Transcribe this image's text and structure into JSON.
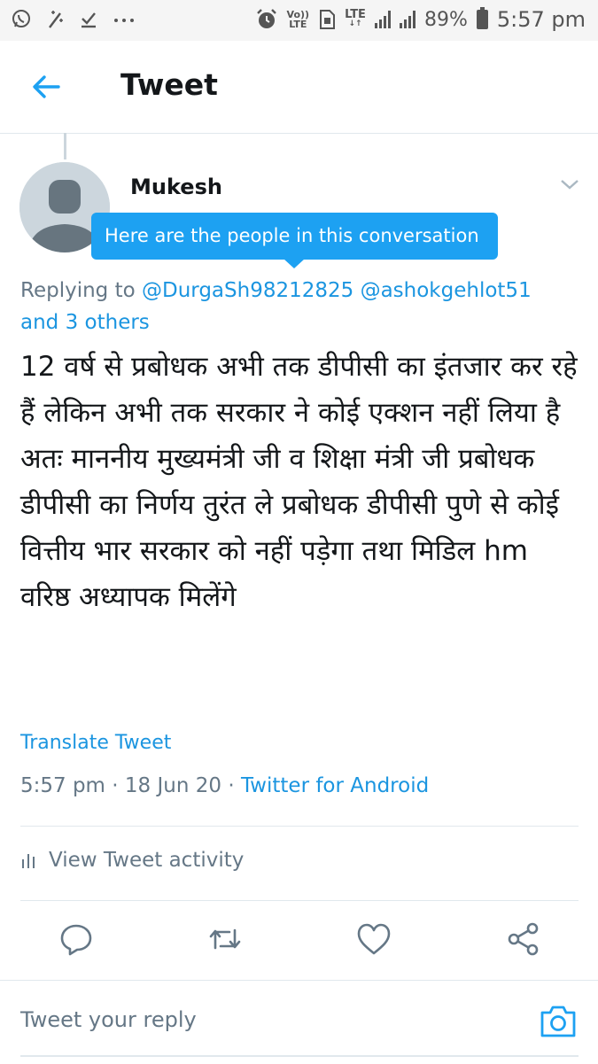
{
  "status_bar": {
    "volte_top": "Vo))",
    "volte_bottom": "LTE",
    "lte_label": "LTE",
    "battery_percent": "89%",
    "time": "5:57 pm"
  },
  "header": {
    "title": "Tweet"
  },
  "tweet": {
    "author_name": "Mukesh",
    "tooltip": "Here are the people in this conversation",
    "replying_prefix": "Replying to",
    "mention_1": "@DurgaSh98212825",
    "mention_2": "@ashokgehlot51",
    "others": "and 3 others",
    "text": "12 वर्ष से प्रबोधक अभी तक डीपीसी का इंतजार कर रहे हैं लेकिन अभी तक सरकार ने कोई एक्शन नहीं लिया है अतः माननीय मुख्यमंत्री जी व शिक्षा मंत्री जी प्रबोधक डीपीसी का निर्णय तुरंत ले प्रबोधक डीपीसी पुणे से कोई वित्तीय भार सरकार को नहीं पड़ेगा तथा मिडिल hm वरिष्ठ अध्यापक मिलेंगे",
    "translate_label": "Translate Tweet",
    "time": "5:57 pm",
    "date": "18 Jun 20",
    "separator": "·",
    "source": "Twitter for Android",
    "activity_label": "View Tweet activity"
  },
  "reply": {
    "placeholder": "Tweet your reply"
  },
  "colors": {
    "accent": "#1da1f2",
    "link": "#1b95e0",
    "muted": "#657786",
    "divider": "#e1e8ed"
  }
}
